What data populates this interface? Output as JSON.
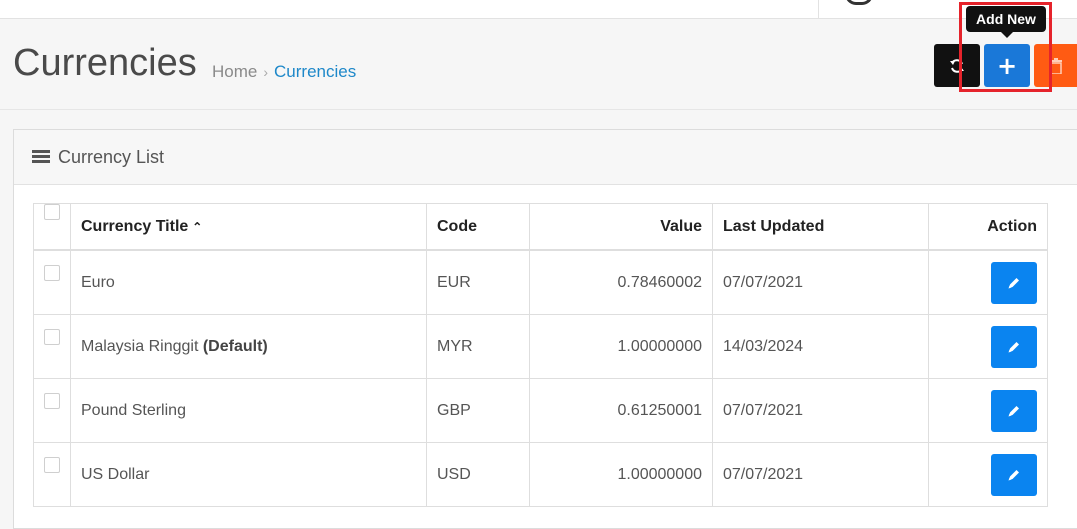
{
  "header": {
    "title": "Currencies",
    "breadcrumb": {
      "home": "Home",
      "separator": "›",
      "current": "Currencies"
    }
  },
  "toolbar": {
    "tooltip": "Add New",
    "refresh_icon": "refresh-icon",
    "add_icon": "plus-icon",
    "add_symbol": "+",
    "delete_icon": "trash-icon"
  },
  "panel": {
    "heading": "Currency List",
    "icon": "list-icon"
  },
  "table": {
    "columns": {
      "title": "Currency Title",
      "code": "Code",
      "value": "Value",
      "updated": "Last Updated",
      "action": "Action"
    },
    "rows": [
      {
        "title": "Euro",
        "default": "",
        "code": "EUR",
        "value": "0.78460002",
        "updated": "07/07/2021"
      },
      {
        "title": "Malaysia Ringgit",
        "default": "(Default)",
        "code": "MYR",
        "value": "1.00000000",
        "updated": "14/03/2024"
      },
      {
        "title": "Pound Sterling",
        "default": "",
        "code": "GBP",
        "value": "0.61250001",
        "updated": "07/07/2021"
      },
      {
        "title": "US Dollar",
        "default": "",
        "code": "USD",
        "value": "1.00000000",
        "updated": "07/07/2021"
      }
    ]
  },
  "colors": {
    "add": "#1a78d8",
    "refresh": "#111111",
    "delete": "#ff5b13",
    "edit": "#0a84f0",
    "highlight": "#e5232b",
    "link": "#1e88c9"
  }
}
